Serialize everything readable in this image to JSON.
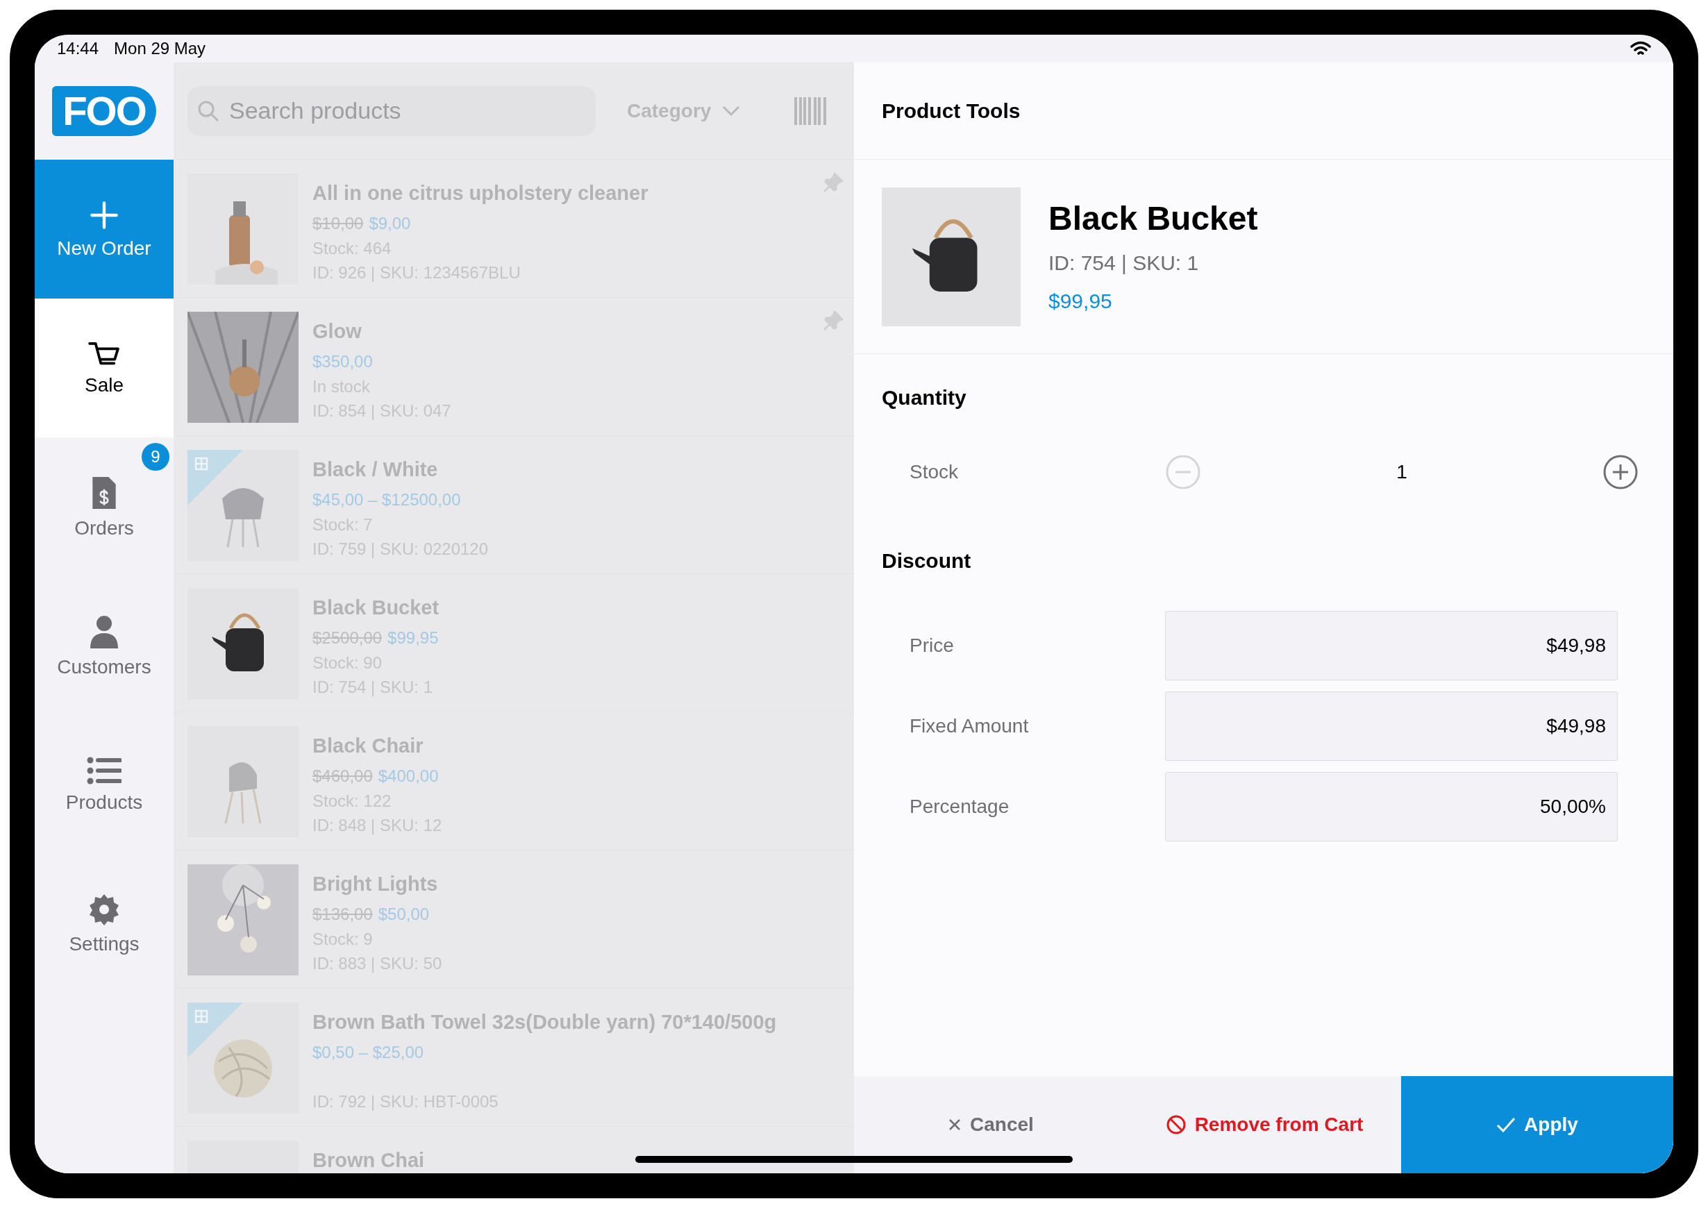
{
  "status_bar": {
    "time": "14:44",
    "date": "Mon 29 May"
  },
  "sidebar": {
    "logo": "FOO",
    "items": [
      {
        "kind": "action",
        "label": "New Order"
      },
      {
        "kind": "nav",
        "label": "Sale",
        "selected": true
      },
      {
        "kind": "nav",
        "label": "Orders",
        "selected": false,
        "badge": "9"
      },
      {
        "kind": "nav",
        "label": "Customers",
        "selected": false
      },
      {
        "kind": "nav",
        "label": "Products",
        "selected": false
      },
      {
        "kind": "nav",
        "label": "Settings",
        "selected": false
      }
    ]
  },
  "product_list": {
    "search": {
      "placeholder": "Search products"
    },
    "category": "Category",
    "products": [
      {
        "name": "All in one citrus upholstery cleaner",
        "old_price": "$10,00",
        "price": "$9,00",
        "stock": "Stock: 464",
        "ids": "ID: 926 | SKU: 1234567BLU",
        "pinned": true,
        "variable": false
      },
      {
        "name": "Glow",
        "price": "$350,00",
        "stock": "In stock",
        "ids": "ID: 854 | SKU: 047",
        "pinned": true,
        "variable": false
      },
      {
        "name": "Black / White",
        "price": "$45,00 – $12500,00",
        "stock": "Stock: 7",
        "ids": "ID: 759 | SKU: 0220120",
        "pinned": false,
        "variable": true
      },
      {
        "name": "Black Bucket",
        "old_price": "$2500,00",
        "price": "$99,95",
        "stock": "Stock: 90",
        "ids": "ID: 754 | SKU: 1",
        "pinned": false,
        "variable": false
      },
      {
        "name": "Black Chair",
        "old_price": "$460,00",
        "price": "$400,00",
        "stock": "Stock: 122",
        "ids": "ID: 848 | SKU: 12",
        "pinned": false,
        "variable": false
      },
      {
        "name": "Bright Lights",
        "old_price": "$136,00",
        "price": "$50,00",
        "stock": "Stock: 9",
        "ids": "ID: 883 | SKU: 50",
        "pinned": false,
        "variable": false
      },
      {
        "name": "Brown Bath Towel 32s(Double yarn) 70*140/500g",
        "price": "$0,50 – $25,00",
        "ids": "ID: 792 | SKU: HBT-0005",
        "pinned": false,
        "variable": true
      },
      {
        "name": "Brown Chai",
        "pinned": false,
        "variable": false
      }
    ]
  },
  "product_tools": {
    "title": "Product Tools",
    "product": {
      "name": "Black Bucket",
      "meta": "ID: 754 | SKU: 1",
      "price": "$99,95"
    },
    "quantity": {
      "heading": "Quantity",
      "label": "Stock",
      "value": "1",
      "minus_disabled": true
    },
    "discount": {
      "heading": "Discount",
      "fields": [
        {
          "label": "Price",
          "value": "$49,98"
        },
        {
          "label": "Fixed Amount",
          "value": "$49,98"
        },
        {
          "label": "Percentage",
          "value": "50,00%"
        }
      ]
    },
    "buttons": [
      {
        "kind": "cancel",
        "label": "Cancel"
      },
      {
        "kind": "remove",
        "label": "Remove from Cart"
      },
      {
        "kind": "apply",
        "label": "Apply"
      }
    ]
  }
}
